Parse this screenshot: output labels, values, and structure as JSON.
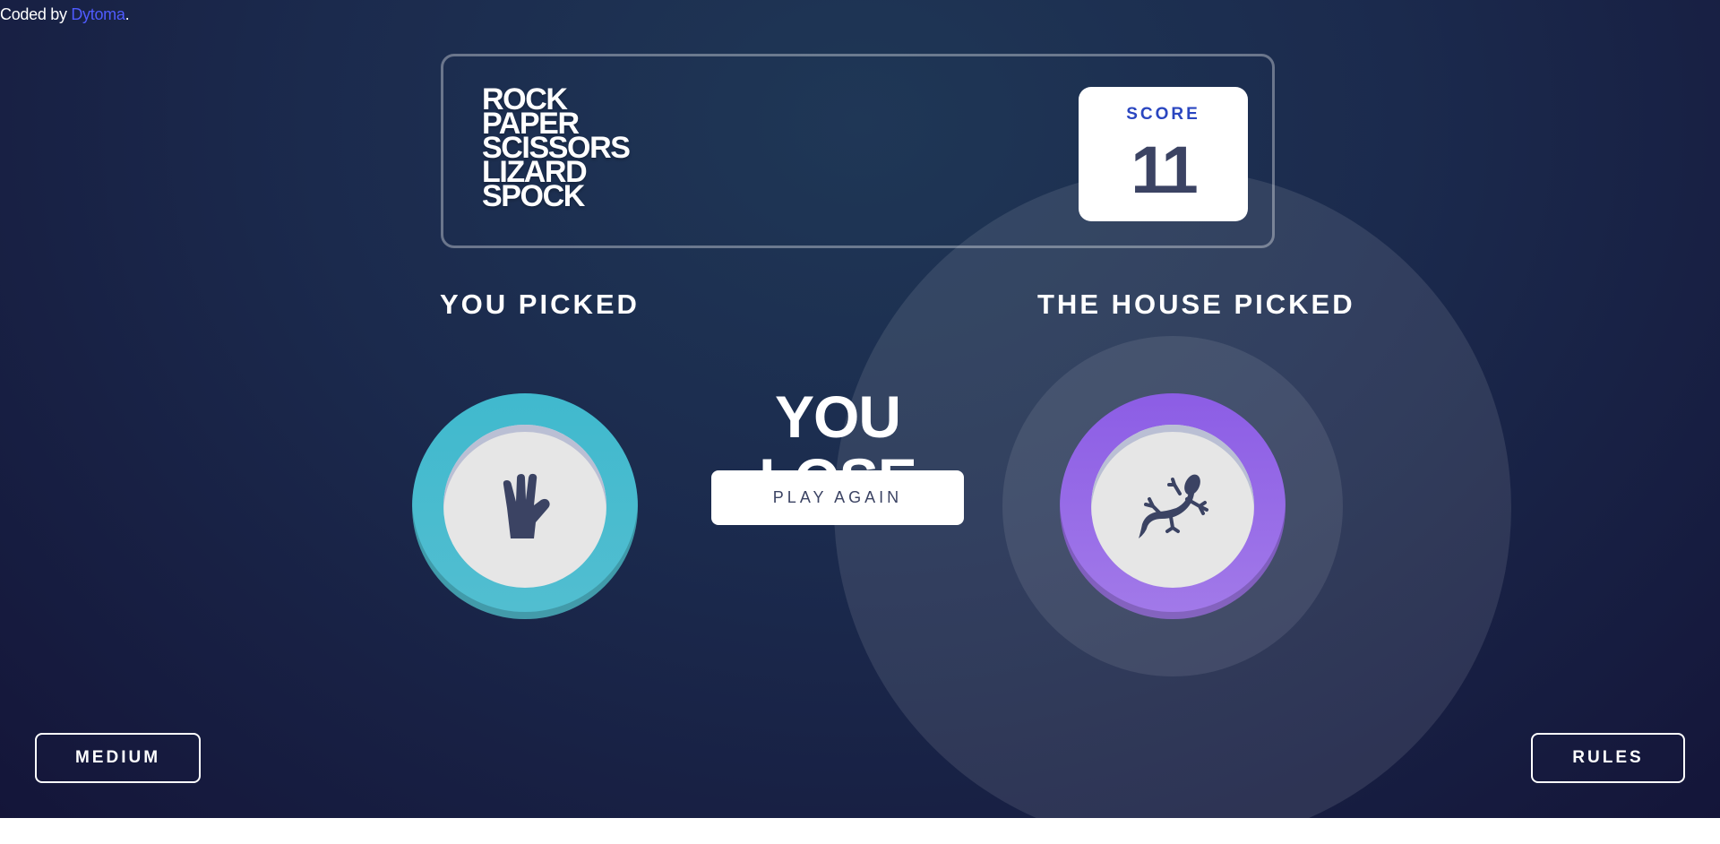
{
  "attribution": {
    "prefix": "Coded by ",
    "author": "Dytoma",
    "suffix": "."
  },
  "header": {
    "title_lines": [
      "ROCK",
      "PAPER",
      "SCISSORS",
      "LIZARD",
      "SPOCK"
    ],
    "score_label": "SCORE",
    "score_value": "11"
  },
  "game": {
    "user_label": "YOU PICKED",
    "house_label": "THE HOUSE PICKED",
    "user_pick": "spock",
    "house_pick": "lizard",
    "result": "YOU LOSE",
    "play_again_label": "PLAY AGAIN"
  },
  "controls": {
    "difficulty_label": "MEDIUM",
    "rules_label": "RULES"
  },
  "colors": {
    "spock": "#40b9ce",
    "lizard": "#8c5de5",
    "score_label": "#2a46c0",
    "dark_text": "#3b4363",
    "link": "#4f5bff"
  },
  "icons": {
    "user_pick_icon": "spock-hand-icon",
    "house_pick_icon": "lizard-icon"
  }
}
